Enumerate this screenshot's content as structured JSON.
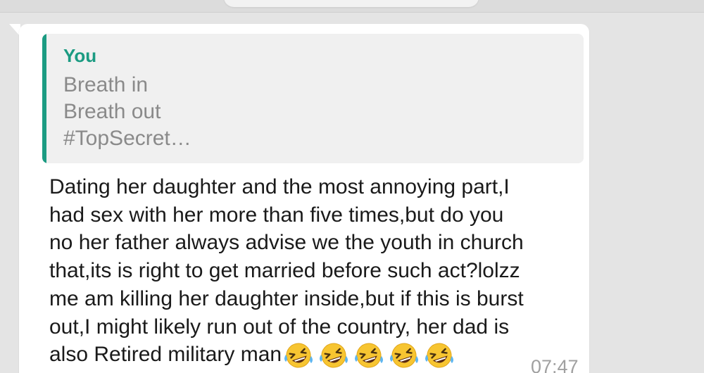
{
  "quote": {
    "author": "You",
    "lines": [
      "Breath in",
      "Breath out",
      "#TopSecret…"
    ]
  },
  "message": {
    "lines": [
      "Dating her daughter and the most annoying part,I",
      "had sex with her more than five times,but do you",
      "no her father always advise we the youth in church",
      "that,its is right to get married before such act?lolzz",
      "me am killing her daughter inside,but if this is burst",
      "out,I might likely run out of the country, her dad is",
      "also Retired military man"
    ],
    "emojis": [
      "rolling-on-floor-laughing-icon",
      "rolling-on-floor-laughing-icon",
      "rolling-on-floor-laughing-icon",
      "rolling-on-floor-laughing-icon",
      "rolling-on-floor-laughing-icon"
    ],
    "time": "07:47"
  },
  "colors": {
    "accent": "#1b9b82",
    "background": "#e4e4e4",
    "bubble": "#ffffff",
    "quote_background": "#f0f0f0"
  }
}
